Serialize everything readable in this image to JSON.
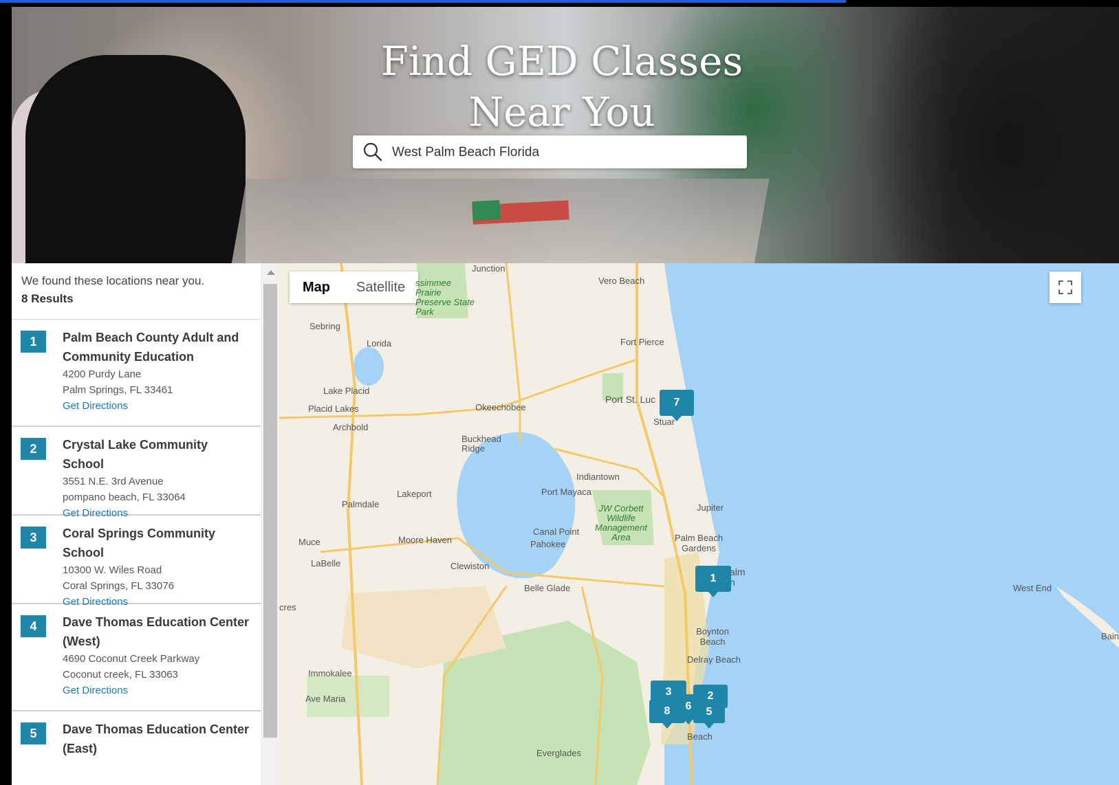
{
  "hero": {
    "title_line1": "Find GED Classes",
    "title_line2": "Near You",
    "search_value": "West Palm Beach Florida"
  },
  "results": {
    "found_text": "We found these locations near you.",
    "count_text": "8 Results",
    "items": [
      {
        "num": "1",
        "name": "Palm Beach County Adult and Community Education",
        "addr1": "4200 Purdy Lane",
        "addr2": "Palm Springs, FL 33461",
        "directions": "Get Directions"
      },
      {
        "num": "2",
        "name": "Crystal Lake Community School",
        "addr1": "3551 N.E. 3rd Avenue",
        "addr2": "pompano beach, FL 33064",
        "directions": "Get Directions"
      },
      {
        "num": "3",
        "name": "Coral Springs Community School",
        "addr1": "10300 W. Wiles Road",
        "addr2": "Coral Springs, FL 33076",
        "directions": "Get Directions"
      },
      {
        "num": "4",
        "name": "Dave Thomas Education Center (West)",
        "addr1": "4690 Coconut Creek Parkway",
        "addr2": "Coconut creek, FL 33063",
        "directions": "Get Directions"
      },
      {
        "num": "5",
        "name": "Dave Thomas Education Center (East)",
        "addr1": "",
        "addr2": "",
        "directions": ""
      }
    ]
  },
  "map": {
    "type_map": "Map",
    "type_satellite": "Satellite",
    "places": {
      "vero": "Vero Beach",
      "kissimmee": "ssimmee Prairie Preserve State Park",
      "sebring": "Sebring",
      "lorida": "Lorida",
      "fortpierce": "Fort Pierce",
      "lakeplacid": "Lake Placid",
      "placidlakes": "Placid Lakes",
      "okeechobee": "Okeechobee",
      "portstluc": "Port St. Luc",
      "stuart": "Stuar",
      "archbold": "Archbold",
      "buckhead": "Buckhead Ridge",
      "indiantown": "Indiantown",
      "portmayaca": "Port Mayaca",
      "lakeport": "Lakeport",
      "palmdale": "Palmdale",
      "jwcorbett": "JW Corbett Wildlife Management Area",
      "jupiter": "Jupiter",
      "muce": "Muce",
      "moorehaven": "Moore Haven",
      "canalpoint": "Canal Point",
      "pahokee": "Pahokee",
      "pbgardens": "Palm Beach Gardens",
      "labelle": "LaBelle",
      "clewiston": "Clewiston",
      "belleglade": "Belle Glade",
      "palm": "alm h",
      "westend": "West End",
      "bain": "Bain",
      "cres": "cres",
      "boynton": "Boynton Beach",
      "delray": "Delray Beach",
      "immokalee": "Immokalee",
      "avemaria": "Ave Maria",
      "beach": "Beach",
      "everglades": "Everglades",
      "junction": "Junction"
    },
    "markers": [
      "7",
      "1",
      "3",
      "8",
      "6",
      "2",
      "5"
    ]
  },
  "colors": {
    "accent": "#1f86a8",
    "link": "#1a78b5",
    "water": "#a5d2f7",
    "land": "#f3efe4",
    "park": "#c6e3b5"
  }
}
